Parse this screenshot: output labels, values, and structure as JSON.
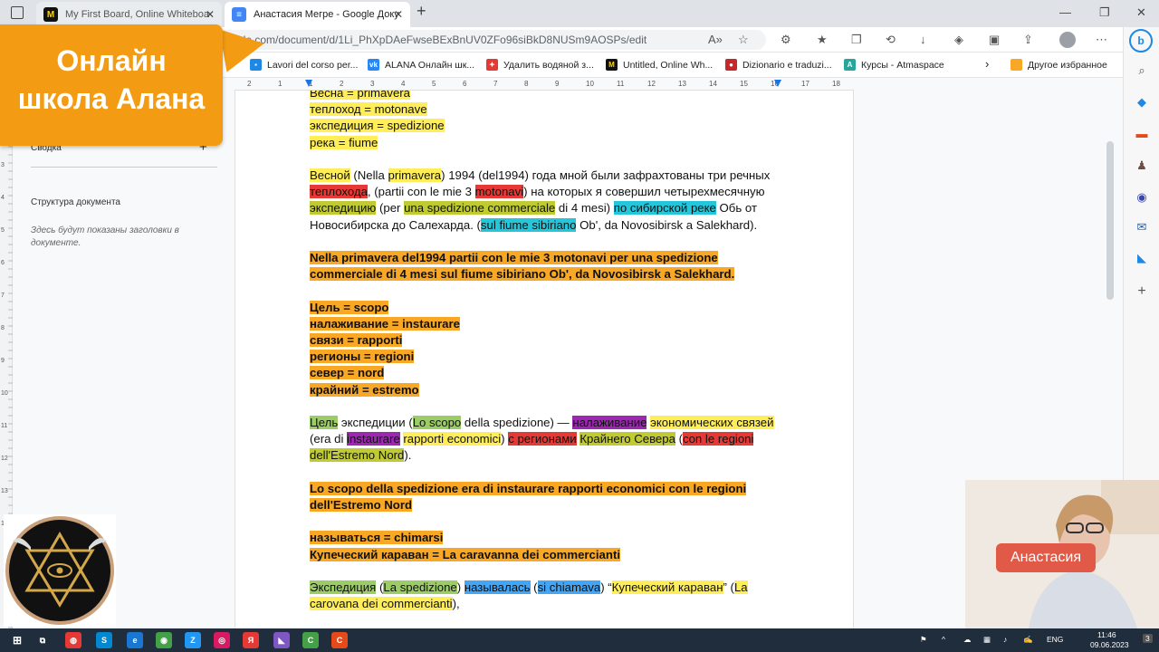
{
  "tabs": [
    {
      "title": "My First Board, Online Whiteboa",
      "icon": "miro-icon"
    },
    {
      "title": "Анастасия Мегре - Google Доку",
      "icon": "google-docs-icon"
    }
  ],
  "window": {
    "new_tab": "+",
    "minimize": "—",
    "restore": "❐",
    "close": "✕"
  },
  "address": {
    "url": "google.com/document/d/1Li_PhXpDAeFwseBExBnUV0ZFo96siBkD8NUSm9AOSPs/edit"
  },
  "favorites": [
    {
      "label": "Lavori del corso per...",
      "icon": "bookmark-icon",
      "color": "#1e88e5"
    },
    {
      "label": "ALANA Онлайн шк...",
      "icon": "vk-icon",
      "color": "#2787f5"
    },
    {
      "label": "Удалить водяной з...",
      "icon": "puzzle-icon",
      "color": "#e53935"
    },
    {
      "label": "Untitled, Online Wh...",
      "icon": "miro-icon",
      "color": "#111"
    },
    {
      "label": "Dizionario e traduzi...",
      "icon": "dictionary-icon",
      "color": "#c62828"
    },
    {
      "label": "Курсы - Atmaspace",
      "icon": "atmaspace-icon",
      "color": "#26a69a"
    },
    {
      "label": "Другое избранное",
      "icon": "folder-icon",
      "color": "#f9a825"
    }
  ],
  "banner": {
    "line1": "Онлайн",
    "line2": "школа Алана"
  },
  "outline": {
    "summary_label": "Сводка",
    "add": "+",
    "structure_label": "Структура документа",
    "placeholder": "Здесь будут показаны заголовки в документе."
  },
  "ruler": [
    "2",
    "1",
    "1",
    "2",
    "3",
    "4",
    "5",
    "6",
    "7",
    "8",
    "9",
    "10",
    "11",
    "12",
    "13",
    "14",
    "15",
    "16",
    "17",
    "18"
  ],
  "vruler": [
    "3",
    "4",
    "5",
    "6",
    "7",
    "8",
    "9",
    "10",
    "11",
    "12",
    "13",
    "14"
  ],
  "doc": {
    "l1": "Весна = primavera",
    "l2": "теплоход = motonave",
    "l3": "экспедиция = spedizione",
    "l4": "река = fiume",
    "p1": [
      "Весной",
      " (Nella ",
      "primavera",
      ") 1994 (del1994) года мной были зафрахтованы три речных ",
      "теплохода",
      ", (partii con le mie 3 ",
      "motonavi",
      ") на которых я совершил четырехмесячную ",
      "экспедицию",
      " (per ",
      "una spedizione commerciale",
      " di 4 mesi) ",
      "по сибирской реке",
      " Обь от Новосибирска до Салехарда. (",
      "sul fiume sibiriano",
      " Ob', da Novosibirsk a Salekhard)."
    ],
    "p2": "Nella primavera del1994 partii con le mie 3 motonavi per una spedizione commerciale di 4 mesi sul fiume sibiriano Ob', da Novosibirsk a Salekhard.",
    "v1": "Цель = scopo",
    "v2": "налаживание = instaurare",
    "v3": "связи = rapporti",
    "v4": "регионы = regioni",
    "v5": "север = nord",
    "v6": "крайний = estremo",
    "p3": [
      "Цель",
      " экспедиции (",
      "Lo scopo",
      " della spedizione) — ",
      "налаживание",
      " ",
      "экономических связей",
      " (era di ",
      "instaurare",
      " ",
      "rapporti economici",
      ") ",
      "с регионами",
      " ",
      "Крайнего Севера",
      " (",
      "con le regioni",
      " ",
      "dell'Estremo Nord",
      ")."
    ],
    "p4": "Lo scopo della spedizione era di instaurare rapporti economici con le regioni dell'Estremo Nord",
    "v7": "называться = chimarsi",
    "v8": "Купеческий караван = La caravanna dei commercianti",
    "p5": [
      "Экспедиция",
      " (",
      "La spedizione",
      ") ",
      "называлась",
      " (",
      "si chiamava",
      ") “",
      "Купеческий караван",
      "” (",
      "La carovana dei commercianti",
      "),"
    ]
  },
  "webcam": {
    "name": "Анастасия"
  },
  "taskbar": {
    "lang": "ENG",
    "time": "11:46",
    "date": "09.06.2023",
    "notif": "3"
  },
  "colors": {
    "banner": "#f39b12",
    "highlight_yellow": "#ffee58",
    "highlight_orange": "#f9a825",
    "highlight_red": "#e53935",
    "highlight_cyan": "#26c6da",
    "highlight_purple": "#9c27b0",
    "highlight_blue": "#42a5f5",
    "highlight_green": "#9ccc65"
  }
}
